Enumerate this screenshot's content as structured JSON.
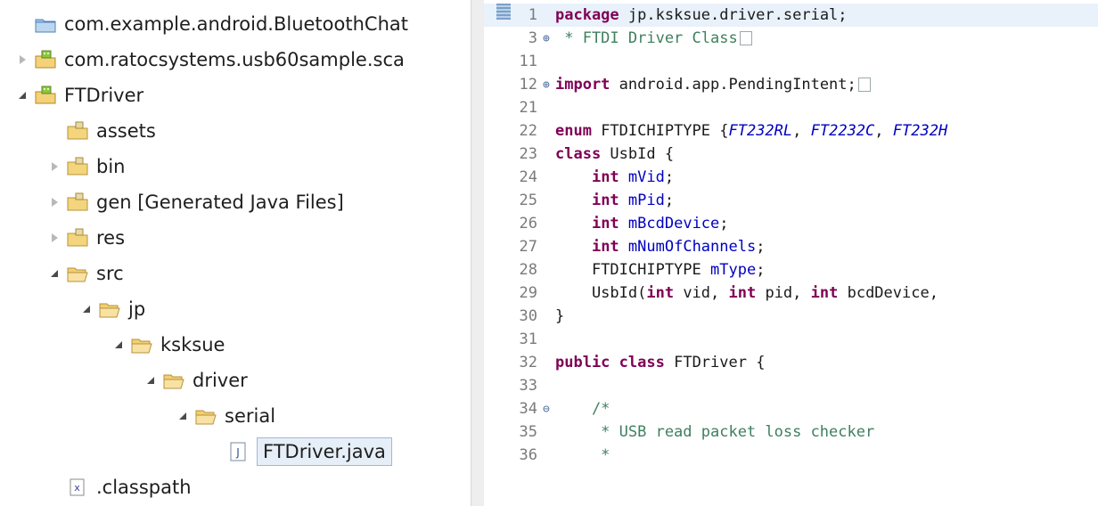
{
  "explorer": {
    "items": [
      {
        "label": "com.example.android.BluetoothChat",
        "icon": "project-folder-icon",
        "twisty": "none",
        "indent": 0
      },
      {
        "label": "com.ratocsystems.usb60sample.sca",
        "icon": "android-project-icon",
        "twisty": "closed",
        "indent": 0
      },
      {
        "label": "FTDriver",
        "icon": "android-project-icon",
        "twisty": "open",
        "indent": 0
      },
      {
        "label": "assets",
        "icon": "package-folder-icon",
        "twisty": "none",
        "indent": 1
      },
      {
        "label": "bin",
        "icon": "package-folder-icon",
        "twisty": "closed",
        "indent": 1
      },
      {
        "label": "gen [Generated Java Files]",
        "icon": "package-folder-icon",
        "twisty": "closed",
        "indent": 1
      },
      {
        "label": "res",
        "icon": "package-folder-icon",
        "twisty": "closed",
        "indent": 1
      },
      {
        "label": "src",
        "icon": "open-folder-icon",
        "twisty": "open",
        "indent": 1
      },
      {
        "label": "jp",
        "icon": "open-folder-icon",
        "twisty": "open",
        "indent": 2
      },
      {
        "label": "ksksue",
        "icon": "open-folder-icon",
        "twisty": "open",
        "indent": 3
      },
      {
        "label": "driver",
        "icon": "open-folder-icon",
        "twisty": "open",
        "indent": 4
      },
      {
        "label": "serial",
        "icon": "open-folder-icon",
        "twisty": "open",
        "indent": 5
      },
      {
        "label": "FTDriver.java",
        "icon": "java-file-icon",
        "twisty": "none",
        "indent": 6,
        "selected": true
      },
      {
        "label": ".classpath",
        "icon": "xml-file-icon",
        "twisty": "none",
        "indent": 1
      }
    ]
  },
  "editor": {
    "lines": [
      {
        "num": "1",
        "fold": "",
        "current": true,
        "tokens": [
          {
            "t": "package",
            "c": "kw"
          },
          {
            "t": " jp.ksksue.driver.serial;",
            "c": "code"
          }
        ]
      },
      {
        "num": "3",
        "fold": "plus",
        "tokens": [
          {
            "t": " * FTDI Driver Class",
            "c": "cmt"
          }
        ],
        "collapsed": true
      },
      {
        "num": "11",
        "fold": "",
        "tokens": []
      },
      {
        "num": "12",
        "fold": "plus",
        "tokens": [
          {
            "t": "import",
            "c": "kw"
          },
          {
            "t": " android.app.PendingIntent;",
            "c": "code"
          }
        ],
        "collapsed": true
      },
      {
        "num": "21",
        "fold": "",
        "tokens": []
      },
      {
        "num": "22",
        "fold": "",
        "tokens": [
          {
            "t": "enum",
            "c": "kw"
          },
          {
            "t": " FTDICHIPTYPE {",
            "c": "code"
          },
          {
            "t": "FT232RL",
            "c": "enumc"
          },
          {
            "t": ", ",
            "c": "code"
          },
          {
            "t": "FT2232C",
            "c": "enumc"
          },
          {
            "t": ", ",
            "c": "code"
          },
          {
            "t": "FT232H",
            "c": "enumc"
          }
        ]
      },
      {
        "num": "23",
        "fold": "",
        "tokens": [
          {
            "t": "class",
            "c": "kw"
          },
          {
            "t": " UsbId {",
            "c": "code"
          }
        ]
      },
      {
        "num": "24",
        "fold": "",
        "tokens": [
          {
            "t": "    ",
            "c": "code"
          },
          {
            "t": "int",
            "c": "kw"
          },
          {
            "t": " ",
            "c": "code"
          },
          {
            "t": "mVid",
            "c": "fld"
          },
          {
            "t": ";",
            "c": "code"
          }
        ]
      },
      {
        "num": "25",
        "fold": "",
        "tokens": [
          {
            "t": "    ",
            "c": "code"
          },
          {
            "t": "int",
            "c": "kw"
          },
          {
            "t": " ",
            "c": "code"
          },
          {
            "t": "mPid",
            "c": "fld"
          },
          {
            "t": ";",
            "c": "code"
          }
        ]
      },
      {
        "num": "26",
        "fold": "",
        "tokens": [
          {
            "t": "    ",
            "c": "code"
          },
          {
            "t": "int",
            "c": "kw"
          },
          {
            "t": " ",
            "c": "code"
          },
          {
            "t": "mBcdDevice",
            "c": "fld"
          },
          {
            "t": ";",
            "c": "code"
          }
        ]
      },
      {
        "num": "27",
        "fold": "",
        "tokens": [
          {
            "t": "    ",
            "c": "code"
          },
          {
            "t": "int",
            "c": "kw"
          },
          {
            "t": " ",
            "c": "code"
          },
          {
            "t": "mNumOfChannels",
            "c": "fld"
          },
          {
            "t": ";",
            "c": "code"
          }
        ]
      },
      {
        "num": "28",
        "fold": "",
        "tokens": [
          {
            "t": "    FTDICHIPTYPE ",
            "c": "code"
          },
          {
            "t": "mType",
            "c": "fld"
          },
          {
            "t": ";",
            "c": "code"
          }
        ]
      },
      {
        "num": "29",
        "fold": "",
        "tokens": [
          {
            "t": "    UsbId(",
            "c": "code"
          },
          {
            "t": "int",
            "c": "kw"
          },
          {
            "t": " vid, ",
            "c": "code"
          },
          {
            "t": "int",
            "c": "kw"
          },
          {
            "t": " pid, ",
            "c": "code"
          },
          {
            "t": "int",
            "c": "kw"
          },
          {
            "t": " bcdDevice,",
            "c": "code"
          }
        ]
      },
      {
        "num": "30",
        "fold": "",
        "tokens": [
          {
            "t": "}",
            "c": "code"
          }
        ]
      },
      {
        "num": "31",
        "fold": "",
        "tokens": []
      },
      {
        "num": "32",
        "fold": "",
        "tokens": [
          {
            "t": "public",
            "c": "kw"
          },
          {
            "t": " ",
            "c": "code"
          },
          {
            "t": "class",
            "c": "kw"
          },
          {
            "t": " FTDriver {",
            "c": "code"
          }
        ]
      },
      {
        "num": "33",
        "fold": "",
        "tokens": []
      },
      {
        "num": "34",
        "fold": "minus",
        "tokens": [
          {
            "t": "    /*",
            "c": "cmt"
          }
        ]
      },
      {
        "num": "35",
        "fold": "",
        "tokens": [
          {
            "t": "     * USB read packet loss checker",
            "c": "cmt"
          }
        ]
      },
      {
        "num": "36",
        "fold": "",
        "tokens": [
          {
            "t": "     *",
            "c": "cmt"
          }
        ]
      }
    ]
  }
}
